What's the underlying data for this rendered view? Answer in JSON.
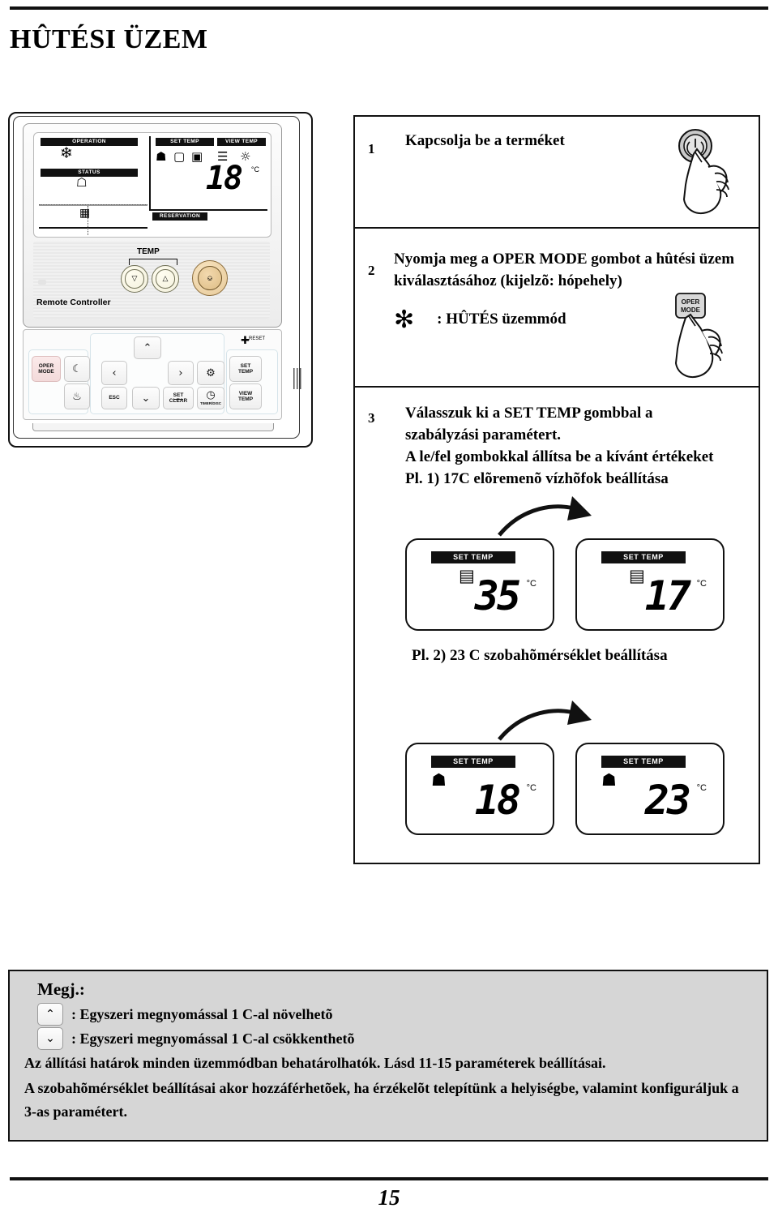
{
  "document": {
    "title": "HÛTÉSI ÜZEM",
    "page_number": "15"
  },
  "remote_controller": {
    "name_label": "Remote Controller",
    "lcd": {
      "tag_operation": "OPERATION",
      "tag_status": "STATUS",
      "tag_set_temp": "SET TEMP",
      "tag_view_temp": "VIEW TEMP",
      "tag_reservation": "RESERVATION",
      "operation_icon": "snowflake-icon",
      "status_icon": "house-power-icon",
      "schedule_icon": "calendar-icon",
      "temp_icons": [
        "house-thermometer-icon",
        "water-in-thermometer-icon",
        "water-out-thermometer-icon",
        "flow-thermometer-icon",
        "outdoor-thermometer-icon"
      ],
      "temp_value": "18",
      "temp_unit": "°C"
    },
    "controls": {
      "temp_label": "TEMP",
      "temp_down_icon": "triangle-down-icon",
      "temp_up_icon": "triangle-up-icon",
      "power_icon": "power-icon"
    },
    "keypad": [
      {
        "name": "oper-mode",
        "label": "OPER\nMODE",
        "type": "text"
      },
      {
        "name": "night-mode",
        "label": "moon-icon",
        "type": "icon",
        "glyph": "☾"
      },
      {
        "name": "shower-mode",
        "label": "shower-icon",
        "type": "icon",
        "glyph": "♨"
      },
      {
        "name": "nav-up",
        "label": "chevron-up-icon",
        "type": "icon",
        "glyph": "⌃"
      },
      {
        "name": "nav-left",
        "label": "chevron-left-icon",
        "type": "icon",
        "glyph": "‹"
      },
      {
        "name": "nav-right",
        "label": "chevron-right-icon",
        "type": "icon",
        "glyph": "›"
      },
      {
        "name": "settings",
        "label": "gear-icon",
        "type": "icon",
        "glyph": "✲"
      },
      {
        "name": "esc",
        "label": "ESC",
        "type": "text"
      },
      {
        "name": "nav-down",
        "label": "chevron-down-icon",
        "type": "icon",
        "glyph": "⌄"
      },
      {
        "name": "set-clear",
        "label": "SET / CLEAR",
        "type": "text"
      },
      {
        "name": "timer",
        "label": "TIMER/DISC",
        "type": "icon",
        "glyph": "◷"
      },
      {
        "name": "set-temp",
        "label": "SET\nTEMP",
        "type": "text"
      },
      {
        "name": "view-temp",
        "label": "VIEW\nTEMP",
        "type": "text"
      }
    ],
    "keypad_labels": {
      "oper_mode_line1": "OPER",
      "oper_mode_line2": "MODE",
      "esc": "ESC",
      "set": "SET",
      "clear": "CLEAR",
      "timer_sub": "TIMER/DISC",
      "set_temp_line1": "SET",
      "set_temp_line2": "TEMP",
      "view_temp_line1": "VIEW",
      "view_temp_line2": "TEMP",
      "reset": "RESET"
    }
  },
  "steps": [
    {
      "number": "1",
      "text": "Kapcsolja be a terméket",
      "illustration": "power-button-press-icon"
    },
    {
      "number": "2",
      "text": "Nyomja meg a OPER MODE gombot a hûtési üzem kiválasztásához (kijelzõ: hópehely)",
      "mode_note": ": HÛTÉS üzemmód",
      "mode_icon": "snowflake-icon",
      "illustration": "oper-mode-button-press-icon",
      "button_label_line1": "OPER",
      "button_label_line2": "MODE"
    },
    {
      "number": "3",
      "text_line1": "Válasszuk ki a SET TEMP gombbal a",
      "text_line2": "szabályzási paramétert.",
      "text_line3": "A le/fel gombokkal állítsa be a kívánt értékeket",
      "text_line4": "Pl. 1) 17C elõremenõ vízhõfok beállítása",
      "example2_caption": "Pl. 2) 23 C szobahõmérséklet beállítása"
    }
  ],
  "examples": [
    {
      "id": "example-1",
      "icon": "water-outlet-thermometer-icon",
      "before": {
        "tag": "SET TEMP",
        "value": "35",
        "unit": "°C"
      },
      "after": {
        "tag": "SET TEMP",
        "value": "17",
        "unit": "°C"
      }
    },
    {
      "id": "example-2",
      "icon": "house-thermometer-icon",
      "before": {
        "tag": "SET TEMP",
        "value": "18",
        "unit": "°C"
      },
      "after": {
        "tag": "SET TEMP",
        "value": "23",
        "unit": "°C"
      }
    }
  ],
  "notes": {
    "title": "Megj.:",
    "items": [
      {
        "icon": "chevron-up-icon",
        "text": ": Egyszeri megnyomással 1 C-al növelhetõ"
      },
      {
        "icon": "chevron-down-icon",
        "text": ": Egyszeri megnyomással 1 C-al csökkenthetõ"
      }
    ],
    "paragraph1": "Az állítási határok minden üzemmódban behatárolhatók. Lásd 11-15 paraméterek beállításai.",
    "paragraph2": "A szobahõmérséklet beállításai akor hozzáférhetõek, ha érzékelõt telepítünk a helyiségbe, valamint konfiguráljuk a 3-as paramétert."
  },
  "colors": {
    "ink": "#111111",
    "notes_background": "#d6d6d6",
    "power_button": "#e8cb9b",
    "oper_mode_button": "#f3dada"
  }
}
